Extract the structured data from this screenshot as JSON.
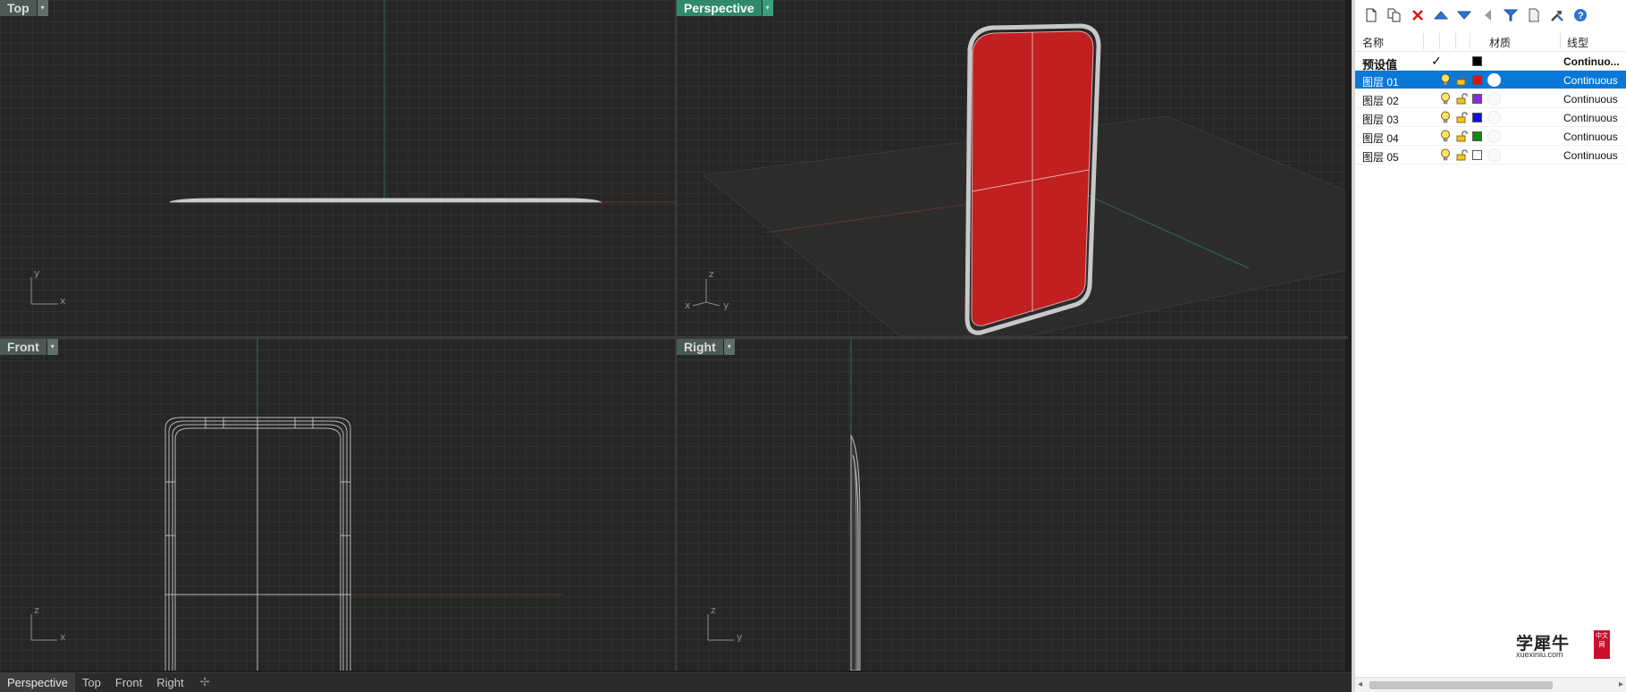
{
  "viewports": {
    "top": {
      "label": "Top",
      "axis": {
        "a": "y",
        "b": "x"
      }
    },
    "perspective": {
      "label": "Perspective",
      "axis": {
        "a": "z",
        "b": "x",
        "c": "y"
      }
    },
    "front": {
      "label": "Front",
      "axis": {
        "a": "z",
        "b": "x"
      }
    },
    "right": {
      "label": "Right",
      "axis": {
        "a": "z",
        "b": "y"
      }
    }
  },
  "tabs": [
    "Perspective",
    "Top",
    "Front",
    "Right"
  ],
  "tabs_add_glyph": "✢",
  "layers_panel": {
    "toolbar_icons": [
      "new-layer-icon",
      "new-sublayer-icon",
      "delete-icon",
      "move-up-icon",
      "move-down-icon",
      "move-left-icon",
      "filter-icon",
      "page-icon",
      "tools-icon",
      "help-icon"
    ],
    "headers": {
      "name": "名称",
      "material": "材质",
      "linetype": "线型"
    },
    "rows": [
      {
        "name": "预设值",
        "current": "✓",
        "color": "#000000",
        "linetype": "Continuo...",
        "bold": true,
        "selected": false,
        "has_icons": false
      },
      {
        "name": "图层 01",
        "current": "",
        "color": "#e01010",
        "linetype": "Continuous",
        "bold": false,
        "selected": true,
        "has_icons": true
      },
      {
        "name": "图层 02",
        "current": "",
        "color": "#8a2be2",
        "linetype": "Continuous",
        "bold": false,
        "selected": false,
        "has_icons": true
      },
      {
        "name": "图层 03",
        "current": "",
        "color": "#1010e0",
        "linetype": "Continuous",
        "bold": false,
        "selected": false,
        "has_icons": true
      },
      {
        "name": "图层 04",
        "current": "",
        "color": "#118811",
        "linetype": "Continuous",
        "bold": false,
        "selected": false,
        "has_icons": true
      },
      {
        "name": "图层 05",
        "current": "",
        "color": "#ffffff",
        "linetype": "Continuous",
        "bold": false,
        "selected": false,
        "has_icons": true
      }
    ]
  },
  "watermark": {
    "title": "学犀牛",
    "url": "xuexiniu.com",
    "badge": "中文网"
  },
  "colors": {
    "accent_active_viewport": "#2f8a6a",
    "selection": "#0a78d6",
    "model_red": "#c0201f"
  }
}
